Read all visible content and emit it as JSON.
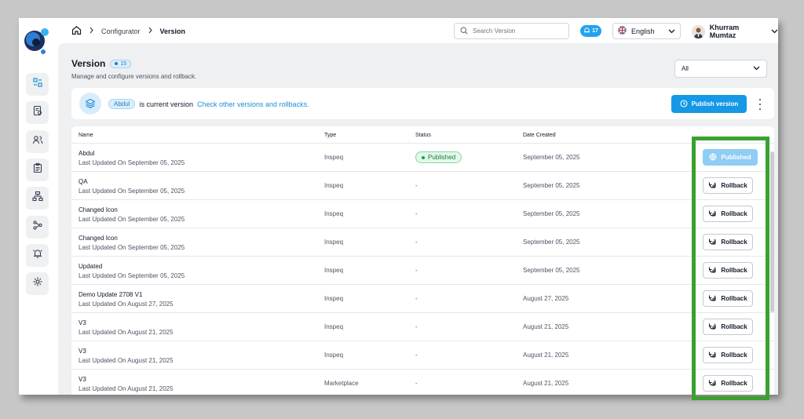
{
  "breadcrumb": {
    "items": [
      "Configurator",
      "Version"
    ]
  },
  "search": {
    "placeholder": "Search Version"
  },
  "notifications": {
    "count": "17"
  },
  "language": {
    "selected": "English"
  },
  "user": {
    "name": "Khurram Mumtaz"
  },
  "page": {
    "title": "Version",
    "count": "15",
    "subtitle": "Manage and configure versions and rollback."
  },
  "filter": {
    "selected": "All"
  },
  "banner": {
    "current": "Abdul",
    "text": "is current version",
    "link": "Check other versions and rollbacks.",
    "publish_label": "Publish version"
  },
  "table": {
    "headers": {
      "name": "Name",
      "type": "Type",
      "status": "Status",
      "date": "Date Created"
    },
    "rows": [
      {
        "name": "Abdul",
        "updated": "Last Updated On September 05, 2025",
        "type": "Inspeq",
        "status": "Published",
        "date": "September 05, 2025",
        "action": "Published"
      },
      {
        "name": "QA",
        "updated": "Last Updated On September 05, 2025",
        "type": "Inspeq",
        "status": "-",
        "date": "September 05, 2025",
        "action": "Rollback"
      },
      {
        "name": "Changed Icon",
        "updated": "Last Updated On September 05, 2025",
        "type": "Inspeq",
        "status": "-",
        "date": "September 05, 2025",
        "action": "Rollback"
      },
      {
        "name": "Changed Icon",
        "updated": "Last Updated On September 05, 2025",
        "type": "Inspeq",
        "status": "-",
        "date": "September 05, 2025",
        "action": "Rollback"
      },
      {
        "name": "Updated",
        "updated": "Last Updated On September 05, 2025",
        "type": "Inspeq",
        "status": "-",
        "date": "September 05, 2025",
        "action": "Rollback"
      },
      {
        "name": "Demo Update 2708 V1",
        "updated": "Last Updated On August 27, 2025",
        "type": "Inspeq",
        "status": "-",
        "date": "August 27, 2025",
        "action": "Rollback"
      },
      {
        "name": "V3",
        "updated": "Last Updated On August 21, 2025",
        "type": "Inspeq",
        "status": "-",
        "date": "August 21, 2025",
        "action": "Rollback"
      },
      {
        "name": "V3",
        "updated": "Last Updated On August 21, 2025",
        "type": "Inspeq",
        "status": "-",
        "date": "August 21, 2025",
        "action": "Rollback"
      },
      {
        "name": "V3",
        "updated": "Last Updated On August 21, 2025",
        "type": "Marketplace",
        "status": "-",
        "date": "August 21, 2025",
        "action": "Rollback"
      }
    ]
  },
  "sidebar": {
    "icons": [
      "versions-icon",
      "reports-icon",
      "users-icon",
      "clipboard-icon",
      "hierarchy-icon",
      "workflow-icon",
      "alarm-icon",
      "settings-icon"
    ]
  },
  "colors": {
    "accent": "#1598e6",
    "highlight": "#3aa12f",
    "published": "#16a34a"
  }
}
